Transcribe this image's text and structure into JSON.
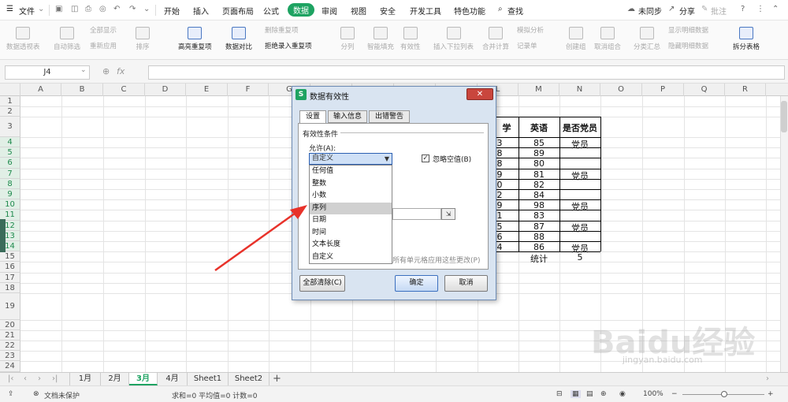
{
  "menubar": {
    "file_label": "文件",
    "tabs": [
      "开始",
      "插入",
      "页面布局",
      "公式",
      "数据",
      "审阅",
      "视图",
      "安全",
      "开发工具",
      "特色功能"
    ],
    "search_label": "查找",
    "sync_label": "未同步",
    "share_label": "分享",
    "comment_label": "批注"
  },
  "ribbon": {
    "items": [
      "数据透视表",
      "自动筛选",
      "全部显示",
      "重新应用",
      "排序",
      "高亮重复项",
      "数据对比",
      "删除重复项",
      "拒绝录入重复项",
      "分列",
      "智能填充",
      "有效性",
      "插入下拉列表",
      "合并计算",
      "模拟分析",
      "记录单",
      "创建组",
      "取消组合",
      "分类汇总",
      "显示明细数据",
      "隐藏明细数据",
      "拆分表格"
    ]
  },
  "formula_bar": {
    "name_box": "J4",
    "fx_label": "fx",
    "formula": ""
  },
  "columns": [
    "A",
    "B",
    "C",
    "D",
    "E",
    "F",
    "G",
    "H",
    "I",
    "J",
    "K",
    "L",
    "M",
    "N",
    "O",
    "P",
    "Q",
    "R"
  ],
  "rows": [
    "1",
    "2",
    "3",
    "4",
    "5",
    "6",
    "7",
    "8",
    "9",
    "10",
    "11",
    "12",
    "13",
    "14",
    "15",
    "16",
    "17",
    "18",
    "19",
    "20",
    "21",
    "22",
    "23",
    "24"
  ],
  "table": {
    "headers": [
      "学",
      "英语",
      "是否党员"
    ],
    "rows": [
      [
        "3",
        "85",
        "党员"
      ],
      [
        "8",
        "89",
        ""
      ],
      [
        "8",
        "80",
        ""
      ],
      [
        "9",
        "81",
        "党员"
      ],
      [
        "0",
        "82",
        ""
      ],
      [
        "2",
        "84",
        ""
      ],
      [
        "9",
        "98",
        "党员"
      ],
      [
        "1",
        "83",
        ""
      ],
      [
        "5",
        "87",
        "党员"
      ],
      [
        "6",
        "88",
        ""
      ],
      [
        "4",
        "86",
        "党员"
      ]
    ],
    "summary_label": "统计",
    "summary_value": "5"
  },
  "sheets": [
    "1月",
    "2月",
    "3月",
    "4月",
    "Sheet1",
    "Sheet2"
  ],
  "active_sheet": "3月",
  "add_sheet": "+",
  "status": {
    "protect": "文档未保护",
    "stats": "求和=0  平均值=0  计数=0",
    "zoom": "100%"
  },
  "dialog": {
    "title": "数据有效性",
    "close": "✕",
    "tabs": [
      "设置",
      "输入信息",
      "出错警告"
    ],
    "group_label": "有效性条件",
    "allow_label": "允许(A):",
    "allow_value": "自定义",
    "ignore_blank": "忽略空值(B)",
    "options": [
      "任何值",
      "整数",
      "小数",
      "序列",
      "日期",
      "时间",
      "文本长度",
      "自定义"
    ],
    "highlighted_option": "序列",
    "apply_all_partial": "所有单元格应用这些更改(P)",
    "clear_all": "全部清除(C)",
    "ok": "确定",
    "cancel": "取消"
  },
  "watermark": {
    "text": "Baidu经验",
    "url": "jingyan.baidu.com"
  },
  "colors": {
    "accent": "#1ea362",
    "arrow": "#e8322a",
    "dialog_bg": "#d9e4f1"
  }
}
